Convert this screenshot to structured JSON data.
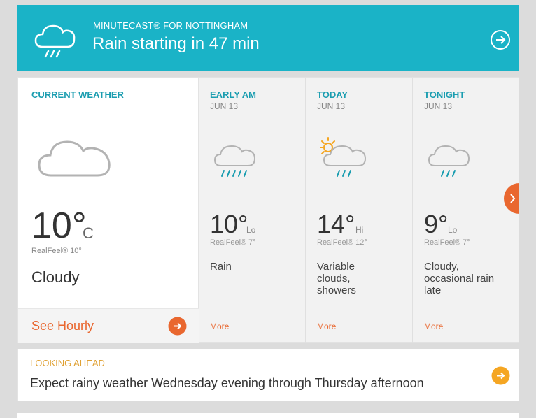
{
  "minutecast": {
    "kicker": "MINUTECAST® FOR NOTTINGHAM",
    "headline": "Rain starting in 47 min",
    "icon": "rain-cloud-icon",
    "go_icon": "arrow-right-circle-icon"
  },
  "current": {
    "title": "CURRENT WEATHER",
    "temp": "10°",
    "unit": "C",
    "realfeel": "RealFeel® 10°",
    "condition": "Cloudy",
    "hourly_label": "See Hourly",
    "icon": "cloud-icon"
  },
  "forecast": [
    {
      "name": "EARLY AM",
      "date": "JUN 13",
      "temp": "10°",
      "hilo": "Lo",
      "realfeel": "RealFeel® 7°",
      "condition": "Rain",
      "more": "More",
      "icon": "rain-cloud-icon"
    },
    {
      "name": "TODAY",
      "date": "JUN 13",
      "temp": "14°",
      "hilo": "Hi",
      "realfeel": "RealFeel® 12°",
      "condition": "Variable clouds, showers",
      "more": "More",
      "icon": "sun-cloud-rain-icon"
    },
    {
      "name": "TONIGHT",
      "date": "JUN 13",
      "temp": "9°",
      "hilo": "Lo",
      "realfeel": "RealFeel® 7°",
      "condition": "Cloudy, occasional rain late",
      "more": "More",
      "icon": "rain-cloud-icon"
    }
  ],
  "looking_ahead": {
    "label": "LOOKING AHEAD",
    "text": "Expect rainy weather Wednesday evening through Thursday afternoon"
  },
  "colors": {
    "teal": "#1ab3c7",
    "orange": "#e9672f",
    "amber": "#f5a623"
  }
}
